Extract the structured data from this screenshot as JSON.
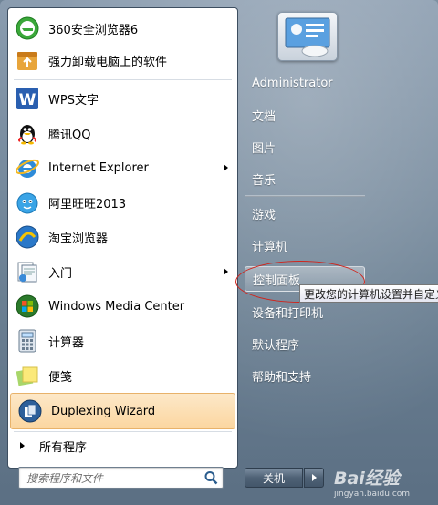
{
  "start_menu": {
    "programs": [
      {
        "label": "360安全浏览器6",
        "icon": "360-browser-icon",
        "has_submenu": false
      },
      {
        "label": "强力卸载电脑上的软件",
        "icon": "uninstall-icon",
        "has_submenu": false
      },
      {
        "label": "WPS文字",
        "icon": "wps-writer-icon",
        "has_submenu": false
      },
      {
        "label": "腾讯QQ",
        "icon": "qq-penguin-icon",
        "has_submenu": false
      },
      {
        "label": "Internet Explorer",
        "icon": "internet-explorer-icon",
        "has_submenu": true
      },
      {
        "label": "阿里旺旺2013",
        "icon": "aliwangwang-icon",
        "has_submenu": false
      },
      {
        "label": "淘宝浏览器",
        "icon": "taobao-browser-icon",
        "has_submenu": false
      },
      {
        "label": "入门",
        "icon": "getting-started-icon",
        "has_submenu": true
      },
      {
        "label": "Windows Media Center",
        "icon": "windows-media-center-icon",
        "has_submenu": false
      },
      {
        "label": "计算器",
        "icon": "calculator-icon",
        "has_submenu": false
      },
      {
        "label": "便笺",
        "icon": "sticky-notes-icon",
        "has_submenu": false
      },
      {
        "label": "Duplexing Wizard",
        "icon": "duplexing-wizard-icon",
        "has_submenu": false,
        "highlighted": true
      }
    ],
    "all_programs": "所有程序",
    "search_placeholder": "搜索程序和文件"
  },
  "right_panel": {
    "items": [
      {
        "label": "Administrator"
      },
      {
        "label": "文档"
      },
      {
        "label": "图片"
      },
      {
        "label": "音乐"
      },
      {
        "label": "游戏"
      },
      {
        "label": "计算机"
      },
      {
        "label": "控制面板",
        "highlighted": true
      },
      {
        "label": "设备和打印机"
      },
      {
        "label": "默认程序"
      },
      {
        "label": "帮助和支持"
      }
    ],
    "tooltip": "更改您的计算机设置并自定义",
    "shutdown_label": "关机"
  },
  "watermark": {
    "brand": "Bai经验",
    "url": "jingyan.baidu.com"
  },
  "colors": {
    "accent_highlight": "#fbd6a0",
    "annotation_red": "#d0241c",
    "panel_blue": "#6c8194"
  }
}
